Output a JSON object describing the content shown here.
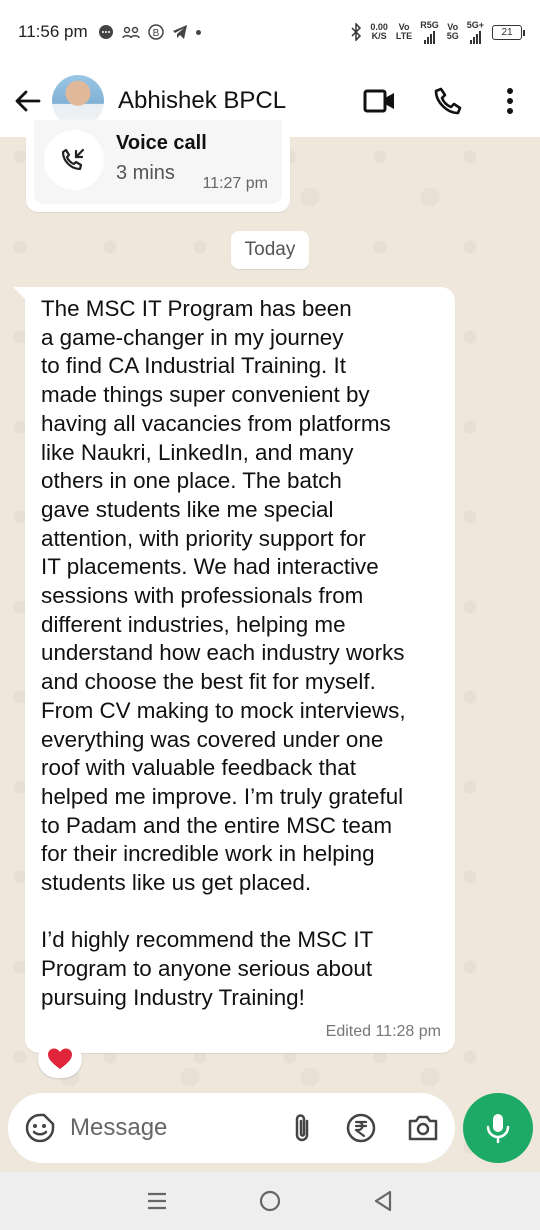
{
  "status_bar": {
    "time": "11:56 pm",
    "net_speed_top": "0.00",
    "net_speed_bottom": "K/S",
    "sim1_top": "Vo",
    "sim1_bottom": "LTE",
    "sim1_label": "R5G",
    "sim2_top": "Vo",
    "sim2_bottom": "5G",
    "sim2_label": "5G+",
    "battery": "21"
  },
  "header": {
    "contact_name": "Abhishek BPCL",
    "icons": [
      "back-arrow-icon",
      "video-call-icon",
      "phone-icon",
      "more-vertical-icon"
    ]
  },
  "call_card": {
    "title": "Voice call",
    "duration": "3 mins",
    "time": "11:27 pm"
  },
  "date_chip": "Today",
  "message": {
    "text": "The MSC IT Program has been\na game-changer in my journey\nto find CA Industrial Training. It\nmade things super convenient by\nhaving all vacancies from platforms\nlike Naukri, LinkedIn, and many\nothers in one place. The batch\ngave students like me special\nattention, with priority support for\nIT placements. We had interactive\nsessions with professionals from\ndifferent industries, helping me\nunderstand how each industry works\nand choose the best fit for myself.\nFrom CV making to mock interviews,\neverything was covered under one\nroof with valuable feedback that\nhelped me improve. I’m truly grateful\nto Padam and the entire MSC team\nfor their incredible work in helping\nstudents like us get placed.\n\nI’d highly recommend the MSC IT\nProgram to anyone serious about\npursuing Industry Training!",
    "meta": "Edited 11:28 pm",
    "reaction": "❤️"
  },
  "input_bar": {
    "placeholder": "Message"
  },
  "colors": {
    "accent_green": "#1da966",
    "chat_background": "#efe7dc",
    "heart_red": "#e0243a"
  }
}
